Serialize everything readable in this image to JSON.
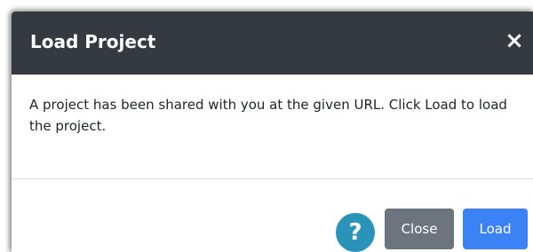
{
  "dialog": {
    "title": "Load Project",
    "close_icon": "×",
    "message": "A project has been shared with you at the given URL. Click Load to load the project."
  },
  "footer": {
    "help_glyph": "?",
    "close_label": "Close",
    "load_label": "Load"
  },
  "colors": {
    "header_bg": "#343a40",
    "help_bg": "#2a93b8",
    "close_btn_bg": "#6c757d",
    "load_btn_bg": "#3b82f6"
  },
  "icons": {
    "close": "close-icon",
    "help": "help-icon"
  }
}
